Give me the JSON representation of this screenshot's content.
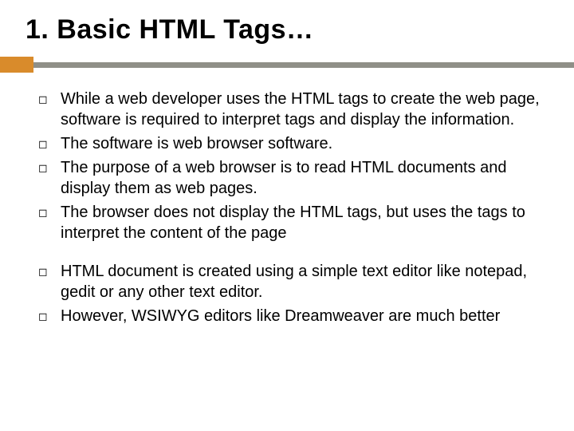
{
  "title": "1. Basic HTML Tags…",
  "groups": [
    {
      "items": [
        "While a web developer uses the HTML tags to create the web page, software is required to interpret tags and display the information.",
        "The software is web browser software.",
        "The purpose of a web browser is to read HTML documents and display them as web pages.",
        "The browser does not display the HTML tags, but uses the tags to interpret the content of the page"
      ]
    },
    {
      "items": [
        "HTML document is created using a simple text editor like notepad, gedit or any other text editor.",
        "However, WSIWYG editors like Dreamweaver are much better"
      ]
    }
  ],
  "bullet_glyph": "◻"
}
